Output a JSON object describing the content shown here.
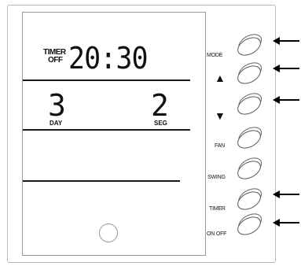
{
  "display": {
    "timer_label_top": "TIMER",
    "timer_label_bottom": "OFF",
    "time": "20:30",
    "left_value": "3",
    "left_unit": "DAY",
    "right_value": "2",
    "right_unit": "SEG"
  },
  "buttons": [
    {
      "label": "MODE"
    },
    {
      "label": "▲"
    },
    {
      "label": "▼"
    },
    {
      "label": "FAN"
    },
    {
      "label": "SWING"
    },
    {
      "label": "TIMER"
    },
    {
      "label": "ON OFF"
    }
  ]
}
